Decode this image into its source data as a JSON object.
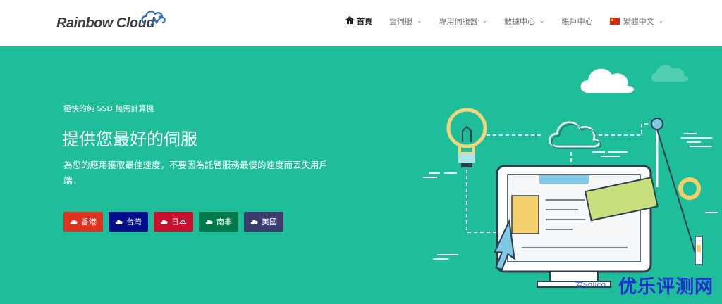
{
  "header": {
    "logo_text": "Rainbow Cloud",
    "nav": [
      {
        "label": "首頁",
        "icon": "home-icon",
        "active": true,
        "has_caret": false
      },
      {
        "label": "雲伺服",
        "has_caret": true
      },
      {
        "label": "專用伺服器",
        "has_caret": true
      },
      {
        "label": "數據中心",
        "has_caret": true
      },
      {
        "label": "賬戶中心",
        "has_caret": false
      },
      {
        "label": "繁體中文",
        "icon": "china-flag-icon",
        "has_caret": true
      }
    ]
  },
  "hero": {
    "subtitle": "極快的純 SSD 無需計算機",
    "title": "提供您最好的伺服",
    "description": "為您的應用獲取最佳速度，不要因為託管服務最慢的速度而丟失用戶端。",
    "buttons": [
      {
        "label": "香港",
        "color": "#e0301e"
      },
      {
        "label": "台灣",
        "color": "#000c8a"
      },
      {
        "label": "日本",
        "color": "#c8102e"
      },
      {
        "label": "南非",
        "color": "#007a4d"
      },
      {
        "label": "美國",
        "color": "#3c3b6e"
      }
    ],
    "background_color": "#1ebe9a"
  },
  "watermark": {
    "main": "优乐评测网",
    "small": "君yolicq"
  }
}
